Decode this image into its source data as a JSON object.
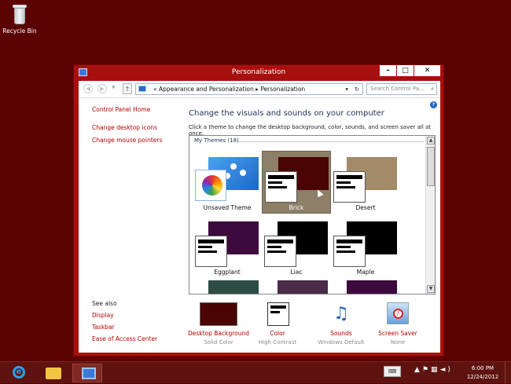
{
  "desktop": {
    "recycle_bin_label": "Recycle Bin",
    "background_color": "#5b0202"
  },
  "window": {
    "title": "Personalization",
    "controls": {
      "minimize": "–",
      "maximize": "□",
      "close": "✕"
    },
    "address": {
      "chevrons": "«",
      "crumb1": "Appearance and Personalization",
      "separator": "▸",
      "crumb2": "Personalization"
    },
    "search_placeholder": "Search Control Pa..."
  },
  "left_nav": {
    "home": "Control Panel Home",
    "links": [
      "Change desktop icons",
      "Change mouse pointers"
    ]
  },
  "see_also": {
    "header": "See also",
    "links": [
      "Display",
      "Taskbar",
      "Ease of Access Center"
    ]
  },
  "main": {
    "heading": "Change the visuals and sounds on your computer",
    "subtext": "Click a theme to change the desktop background, color, sounds, and screen saver all at once.",
    "group_label": "My Themes (18)",
    "themes": [
      {
        "name": "Unsaved Theme",
        "color": "#3b8ee8"
      },
      {
        "name": "Brick",
        "color": "#4a0404",
        "selected": true
      },
      {
        "name": "Desert",
        "color": "#a38a69"
      },
      {
        "name": "Eggplant",
        "color": "#3d0a3d"
      },
      {
        "name": "Liac",
        "color": "#000000"
      },
      {
        "name": "Maple",
        "color": "#000000"
      }
    ],
    "partial_theme_colors": [
      "#2e4d44",
      "#4a2b4a",
      "#3d0a3d"
    ]
  },
  "bottom": [
    {
      "label": "Desktop Background",
      "value": "Solid Color",
      "icon": "solid-color-swatch",
      "color": "#4a0404"
    },
    {
      "label": "Color",
      "value": "High Contrast",
      "icon": "high-contrast-window-icon"
    },
    {
      "label": "Sounds",
      "value": "Windows Default",
      "icon": "music-notes-icon"
    },
    {
      "label": "Screen Saver",
      "value": "None",
      "icon": "screen-saver-none-icon"
    }
  ],
  "taskbar": {
    "keyboard": "⌨",
    "time": "6:00 PM",
    "date": "12/24/2012"
  }
}
